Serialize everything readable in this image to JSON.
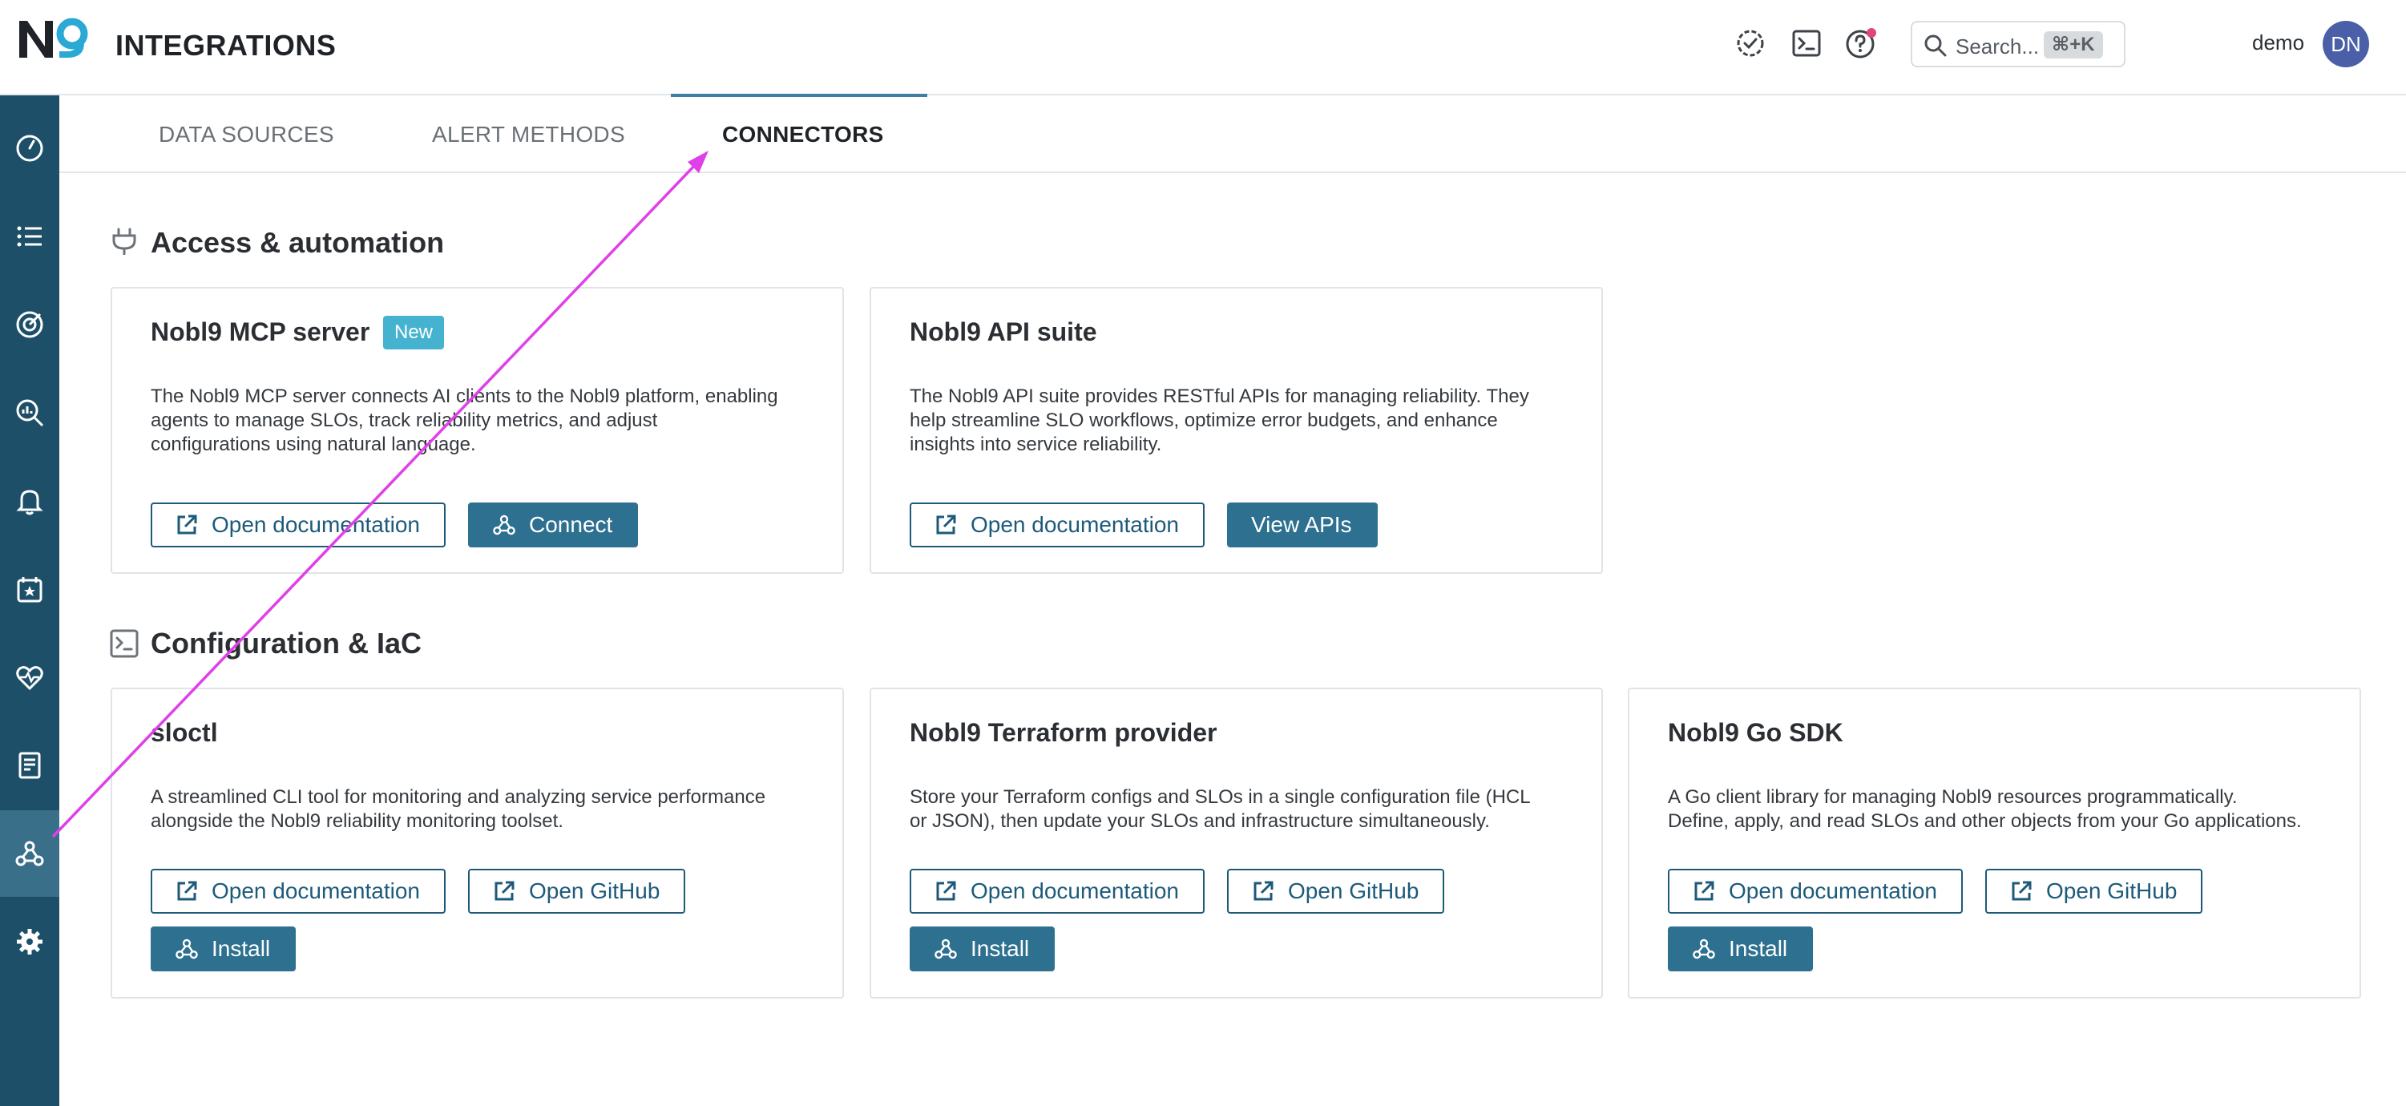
{
  "header": {
    "logo_text": "N9",
    "title": "INTEGRATIONS",
    "icons": [
      "check-badge-icon",
      "terminal-icon",
      "help-icon"
    ],
    "search": {
      "placeholder": "Search...",
      "shortcut": "⌘+K"
    },
    "user": {
      "name": "demo",
      "initials": "DN"
    }
  },
  "sidebar": {
    "items": [
      {
        "icon": "gauge-icon"
      },
      {
        "icon": "list-icon"
      },
      {
        "icon": "target-icon"
      },
      {
        "icon": "analytics-search-icon"
      },
      {
        "icon": "bell-icon"
      },
      {
        "icon": "calendar-star-icon"
      },
      {
        "icon": "heart-pulse-icon"
      },
      {
        "icon": "report-icon"
      },
      {
        "icon": "webhook-icon",
        "active": true
      },
      {
        "icon": "gear-icon"
      }
    ]
  },
  "tabs": [
    {
      "label": "DATA SOURCES",
      "active": false
    },
    {
      "label": "ALERT METHODS",
      "active": false
    },
    {
      "label": "CONNECTORS",
      "active": true
    }
  ],
  "sections": [
    {
      "title": "Access & automation",
      "icon": "plug-icon",
      "cards": [
        {
          "title": "Nobl9 MCP server",
          "badge": "New",
          "description": [
            "The Nobl9 MCP server connects AI clients to the Nobl9 platform, enabling",
            "agents to manage SLOs, track reliability metrics, and adjust",
            "configurations using natural language."
          ],
          "buttons": [
            "Open documentation",
            "Connect"
          ]
        },
        {
          "title": "Nobl9 API suite",
          "description": [
            "The Nobl9 API suite provides RESTful APIs for managing reliability. They",
            "help streamline SLO workflows, optimize error budgets, and enhance",
            "insights into service reliability."
          ],
          "buttons": [
            "Open documentation",
            "View APIs"
          ]
        }
      ]
    },
    {
      "title": "Configuration & IaC",
      "icon": "terminal-box-icon",
      "cards": [
        {
          "title": "sloctl",
          "description": [
            "A streamlined CLI tool for monitoring and analyzing service performance",
            "alongside the Nobl9 reliability monitoring toolset."
          ],
          "buttons": [
            "Open documentation",
            "Open GitHub",
            "Install"
          ]
        },
        {
          "title": "Nobl9 Terraform provider",
          "description": [
            "Store your Terraform configs and SLOs in a single configuration file (HCL",
            "or JSON), then update your SLOs and infrastructure simultaneously."
          ],
          "buttons": [
            "Open documentation",
            "Open GitHub",
            "Install"
          ]
        },
        {
          "title": "Nobl9 Go SDK",
          "description": [
            "A Go client library for managing Nobl9 resources programmatically.",
            "Define, apply, and read SLOs and other objects from your Go applications."
          ],
          "buttons": [
            "Open documentation",
            "Open GitHub",
            "Install"
          ]
        }
      ]
    }
  ],
  "colors": {
    "sidebar": "#1d4f68",
    "sidebar_active": "#3a6f8a",
    "primary": "#2e7090",
    "badge": "#45b3cf",
    "annotation_arrow": "#e040e8"
  }
}
